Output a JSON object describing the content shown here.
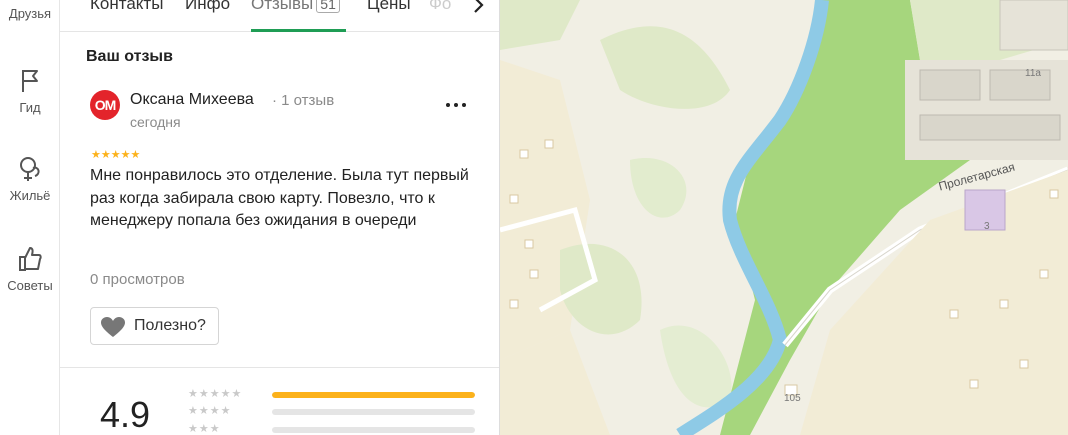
{
  "rail": {
    "items": [
      {
        "label": "Друзья",
        "icon": "friends-icon"
      },
      {
        "label": "Гид",
        "icon": "flag-icon"
      },
      {
        "label": "Жильё",
        "icon": "housing-icon"
      },
      {
        "label": "Советы",
        "icon": "thumbs-up-icon"
      }
    ]
  },
  "tabs": {
    "items": [
      "Контакты",
      "Инфо",
      "Отзывы",
      "Цены",
      "Фо"
    ],
    "active": "Отзывы",
    "reviews_count": "51"
  },
  "review": {
    "section_title": "Ваш отзыв",
    "avatar_initials": "ОМ",
    "author_name": "Оксана Михеева",
    "author_reviews": "· 1 отзыв",
    "date": "сегодня",
    "stars": "★★★★★",
    "rating": 5,
    "text": "Мне понравилось это отделение. Была тут первый раз когда забирала свою карту. Повезло, что к менеджеру попала без ожидания в очереди",
    "views": "0 просмотров",
    "useful_label": "Полезно?"
  },
  "summary": {
    "rating": "4.9",
    "rows": [
      {
        "stars": "★★★★★",
        "fraction": 1.0
      },
      {
        "stars": "★★★★",
        "fraction": 0.0
      },
      {
        "stars": "★★★",
        "fraction": 0.0
      }
    ]
  },
  "map": {
    "street_name": "Пролетарская",
    "house_numbers": [
      "11а",
      "3",
      "105"
    ]
  },
  "colors": {
    "accent": "#1f9d55",
    "star": "#fcb21b",
    "avatar": "#e3242b"
  }
}
